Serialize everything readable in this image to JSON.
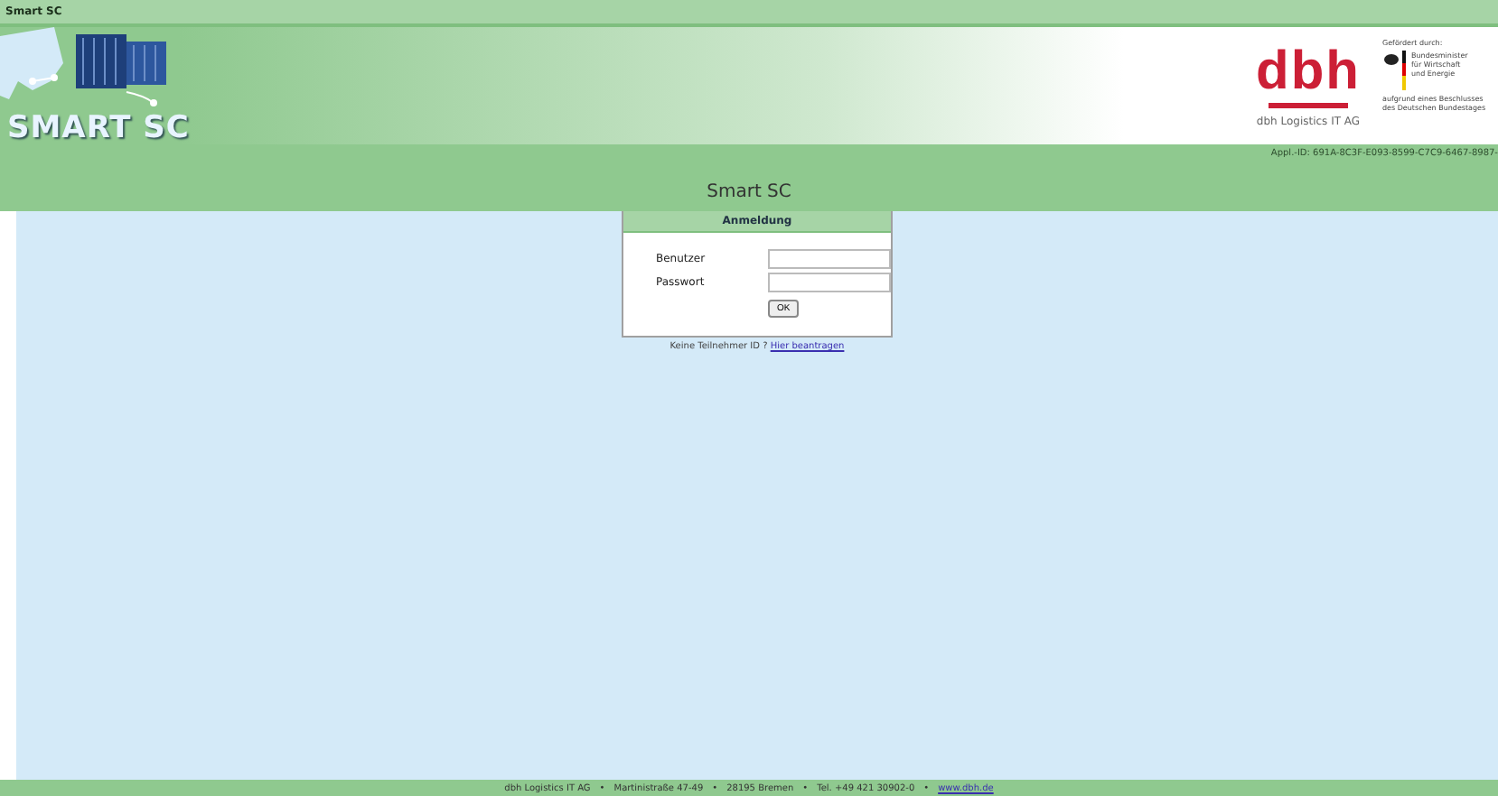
{
  "window": {
    "title": "Smart SC"
  },
  "banner": {
    "logo_text": "SMART SC",
    "company_mark": "dbh",
    "company_name": "dbh Logistics IT AG",
    "funding_label": "Gefördert durch:",
    "ministry_lines": [
      "Bundesminister",
      "für Wirtschaft",
      "und Energie"
    ],
    "funding_note": [
      "aufgrund eines Beschlusses",
      "des Deutschen Bundestages"
    ]
  },
  "app_id": "Appl.-ID: 691A-8C3F-E093-8599-C7C9-6467-8987-",
  "page_title": "Smart SC",
  "login": {
    "title": "Anmeldung",
    "fields": [
      {
        "label": "Benutzer"
      },
      {
        "label": "Passwort"
      }
    ],
    "button": "OK"
  },
  "register": {
    "text": "Keine Teilnehmer ID ?",
    "link": "Hier beantragen"
  },
  "footer": {
    "separator": "•",
    "items": [
      {
        "text": "dbh Logistics IT AG",
        "kind": "text"
      },
      {
        "text": "Martinistraße 47-49",
        "kind": "text"
      },
      {
        "text": "28195 Bremen",
        "kind": "text"
      },
      {
        "text": "Tel. +49 421 30902-0",
        "kind": "text"
      },
      {
        "text": "www.dbh.de",
        "kind": "link"
      }
    ]
  }
}
